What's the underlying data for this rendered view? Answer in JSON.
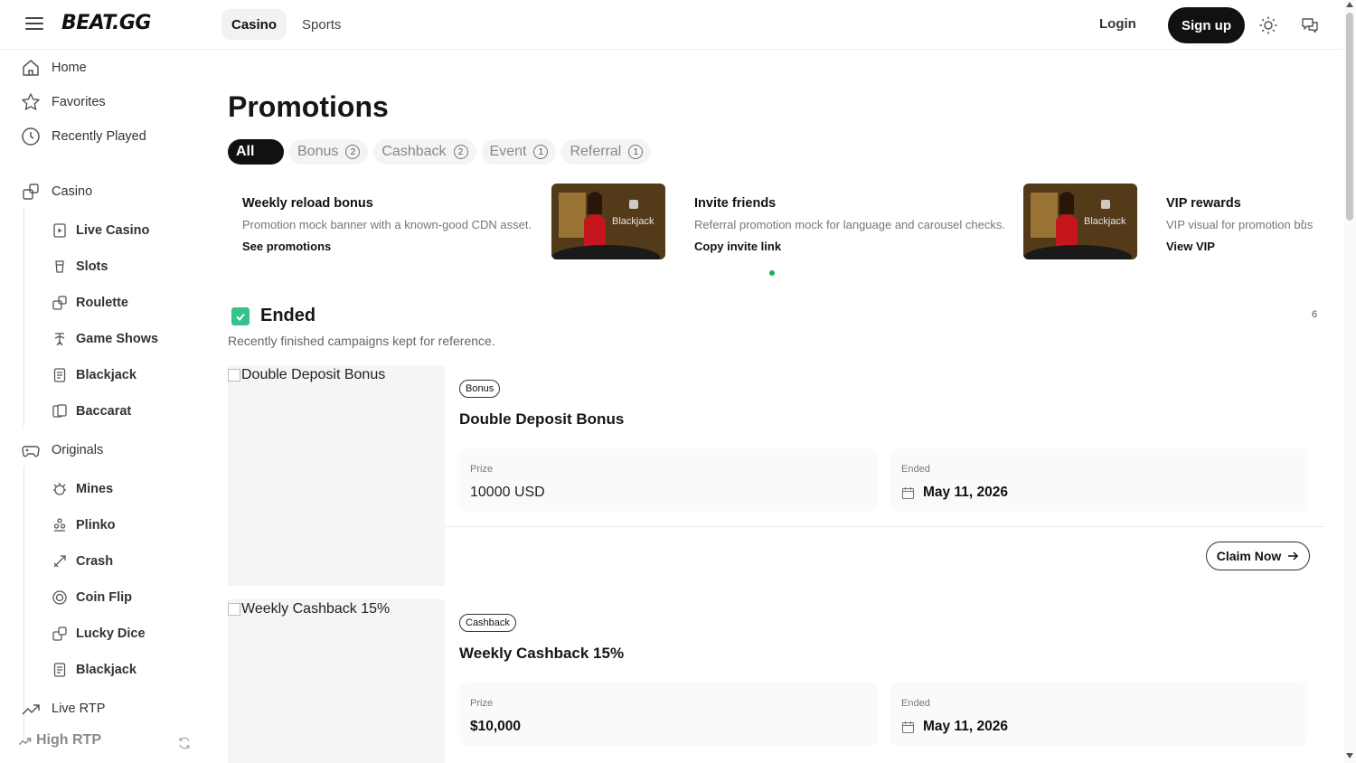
{
  "header": {
    "logo": "BEAT.GG",
    "tabs": [
      {
        "label": "Casino"
      },
      {
        "label": "Sports"
      }
    ],
    "login_label": "Login",
    "signup_label": "Sign up"
  },
  "sidebar": {
    "main": [
      {
        "label": "Home",
        "icon": "home-icon"
      },
      {
        "label": "Favorites",
        "icon": "star-icon"
      },
      {
        "label": "Recently Played",
        "icon": "clock-icon"
      }
    ],
    "casino": {
      "label": "Casino",
      "items": [
        {
          "label": "Live Casino"
        },
        {
          "label": "Slots"
        },
        {
          "label": "Roulette"
        },
        {
          "label": "Game Shows"
        },
        {
          "label": "Blackjack"
        },
        {
          "label": "Baccarat"
        }
      ]
    },
    "originals": {
      "label": "Originals",
      "items": [
        {
          "label": "Mines"
        },
        {
          "label": "Plinko"
        },
        {
          "label": "Crash"
        },
        {
          "label": "Coin Flip"
        },
        {
          "label": "Lucky Dice"
        },
        {
          "label": "Blackjack"
        }
      ]
    },
    "live_rtp": "Live RTP",
    "high_rtp": "High RTP"
  },
  "main": {
    "title": "Promotions",
    "filters": [
      {
        "label": "All",
        "count": ""
      },
      {
        "label": "Bonus",
        "count": "2"
      },
      {
        "label": "Cashback",
        "count": "2"
      },
      {
        "label": "Event",
        "count": "1"
      },
      {
        "label": "Referral",
        "count": "1"
      }
    ],
    "carousel": [
      {
        "title": "Weekly reload bonus",
        "desc": "Promotion mock banner with a known-good CDN asset.",
        "link": "See promotions",
        "img_label": "Blackjack"
      },
      {
        "title": "Invite friends",
        "desc": "Referral promotion mock for language and carousel checks.",
        "link": "Copy invite link",
        "img_label": "Blackjack"
      },
      {
        "title": "VIP rewards",
        "desc": "VIP visual for promotion   bus",
        "link": "View VIP"
      }
    ],
    "section": {
      "title": "Ended",
      "count": "6",
      "desc": "Recently finished campaigns kept for reference."
    },
    "cards": [
      {
        "img_alt": "Double Deposit Bonus",
        "badge": "Bonus",
        "title": "Double Deposit Bonus",
        "prize_label": "Prize",
        "prize": "10000 USD",
        "ended_label": "Ended",
        "ended": "May 11, 2026",
        "claim": "Claim Now"
      },
      {
        "img_alt": "Weekly Cashback 15%",
        "badge": "Cashback",
        "title": "Weekly Cashback 15%",
        "prize_label": "Prize",
        "prize": "$10,000",
        "ended_label": "Ended",
        "ended": "May 11, 2026"
      }
    ]
  },
  "colors": {
    "accent_green": "#36c28b",
    "dot_green": "#1ab05a",
    "dark": "#111111"
  }
}
